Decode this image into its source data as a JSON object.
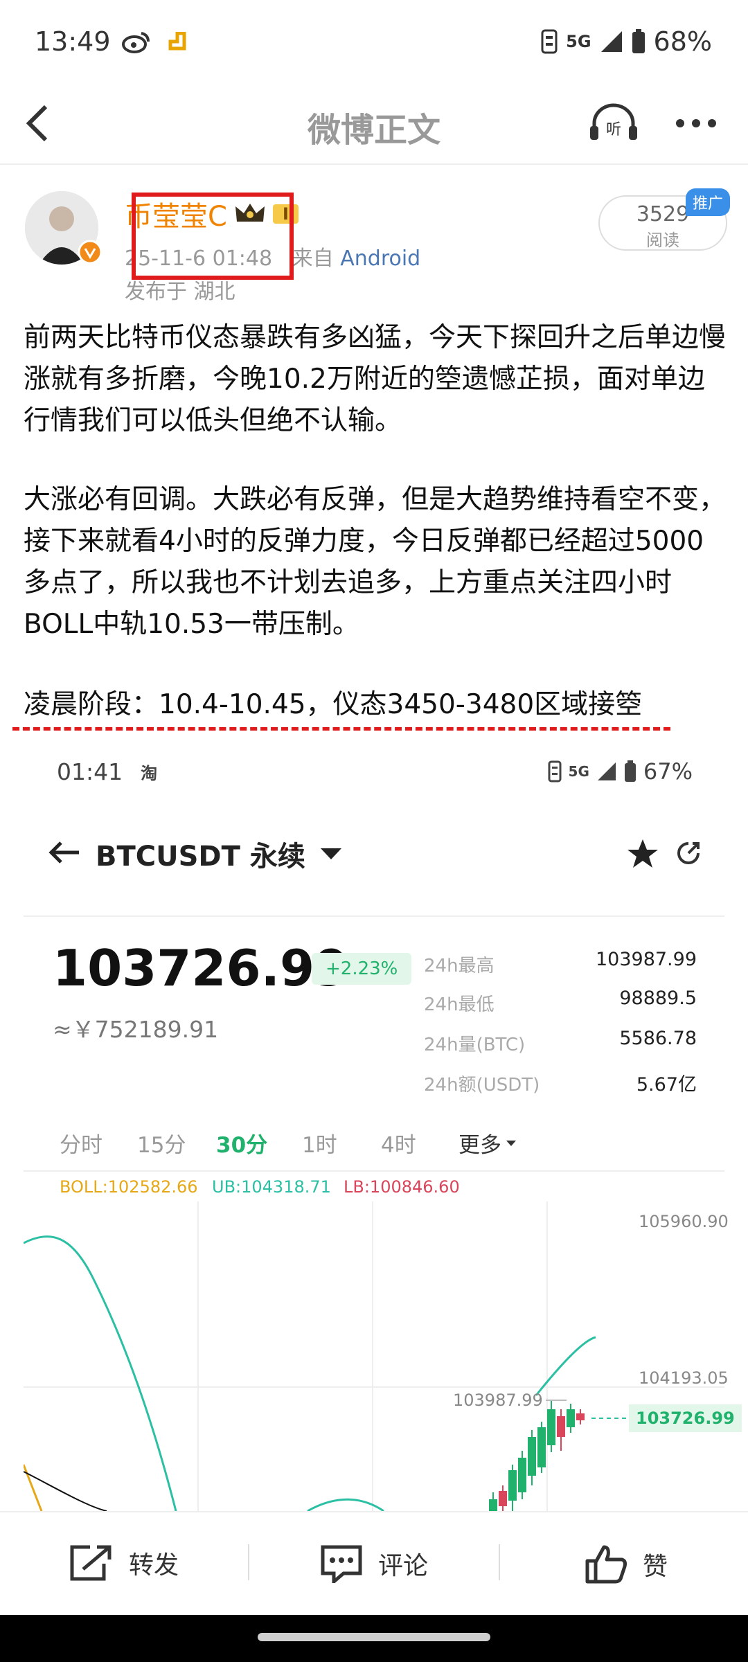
{
  "status_bar": {
    "time": "13:49",
    "network": "5G",
    "battery": "68%"
  },
  "header": {
    "title": "微博正文"
  },
  "author": {
    "name": "币莹莹C",
    "level": "I",
    "date": "25-11-6 01:48",
    "source_prefix": "来自",
    "source": "Android",
    "location": "发布于 湖北"
  },
  "read_stat": {
    "count": "3529",
    "label": "阅读",
    "badge": "推广"
  },
  "post": {
    "p1": "前两天比特币仪态暴跌有多凶猛，今天下探回升之后单边慢涨就有多折磨，今晚10.2万附近的箜遗憾芷损，面对单边行情我们可以低头但绝不认输。",
    "p2": "大涨必有回调。大跌必有反弹，但是大趋势维持看空不变，接下来就看4小时的反弹力度，今日反弹都已经超过5000多点了，所以我也不计划去追多，上方重点关注四小时BOLL中轨10.53一带压制。",
    "p3": "凌晨阶段：10.4-10.45，仪态3450-3480区域接箜"
  },
  "embedded": {
    "status": {
      "time": "01:41",
      "app": "淘",
      "network": "5G",
      "battery": "67%"
    },
    "pair": "BTCUSDT 永续",
    "price": "103726.99",
    "change": "+2.23%",
    "cny": "≈￥752189.91",
    "stats": [
      {
        "label": "24h最高",
        "value": "103987.99"
      },
      {
        "label": "24h最低",
        "value": "98889.5"
      },
      {
        "label": "24h量(BTC)",
        "value": "5586.78"
      },
      {
        "label": "24h额(USDT)",
        "value": "5.67亿"
      }
    ],
    "timeframes": [
      "分时",
      "15分",
      "30分",
      "1时",
      "4时",
      "更多"
    ],
    "active_timeframe": "30分",
    "boll": {
      "mid": "BOLL:102582.66",
      "ub": "UB:104318.71",
      "lb": "LB:100846.60"
    },
    "colors": {
      "up": "#20b26c",
      "down": "#d9455a",
      "boll_mid": "#e6a817",
      "ub": "#2bbfa4",
      "lb": "#d9455a"
    },
    "axis": {
      "top": "105960.90",
      "mid": "104193.05",
      "high_marker": "103987.99",
      "last": "103726.99"
    }
  },
  "actions": {
    "repost": "转发",
    "comment": "评论",
    "like": "赞"
  }
}
